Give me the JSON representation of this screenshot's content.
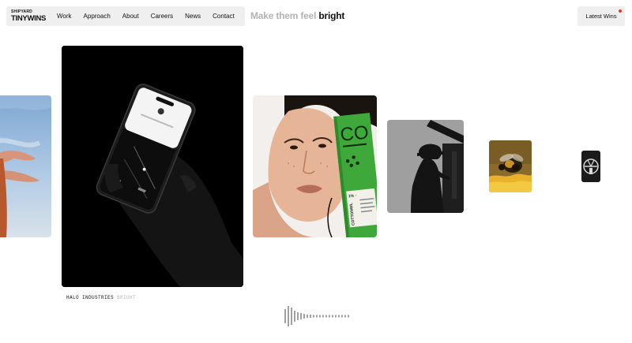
{
  "brand": {
    "small": "SHIPYARD",
    "name": "TINYWINS"
  },
  "nav": {
    "items": [
      "Work",
      "Approach",
      "About",
      "Careers",
      "News",
      "Contact"
    ]
  },
  "tagline": {
    "muted": "Make them feel",
    "strong": "bright"
  },
  "latest_wins": {
    "label": "Latest Wins"
  },
  "packaging": {
    "brand_text": "CO",
    "line1": "1% ·",
    "line2": "COTTONWL"
  },
  "caption": {
    "project": "HALO INDUSTRIES",
    "word": "BRIGHT"
  },
  "colors": {
    "accent": "#e63a2e",
    "packaging_green": "#3ea83a",
    "nav_bg": "#efefef",
    "muted_text": "#b3b3b3"
  },
  "icons": [
    "scroll-wave-indicator",
    "notification-dot"
  ]
}
